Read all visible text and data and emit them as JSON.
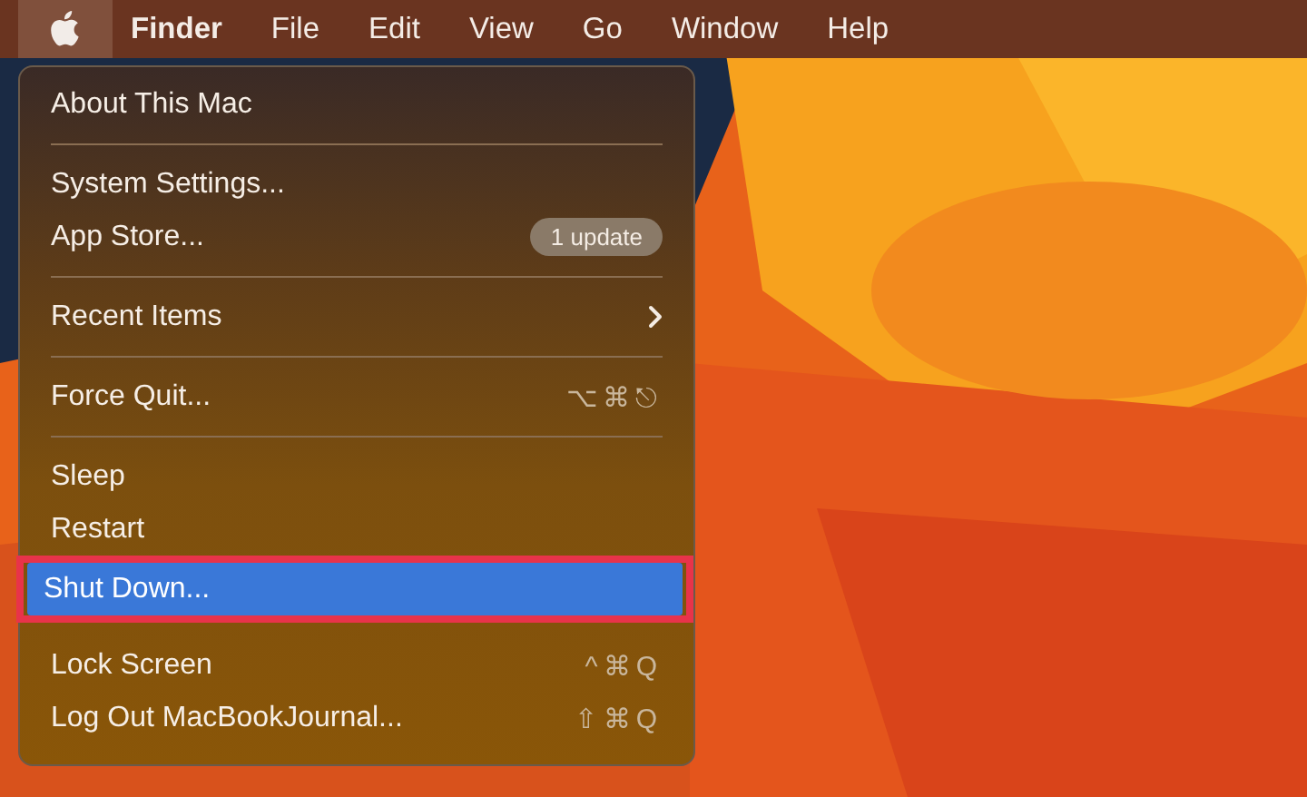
{
  "menu_bar": {
    "apple_menu_selected": true,
    "items": [
      {
        "label": "Finder",
        "bold": true
      },
      {
        "label": "File",
        "bold": false
      },
      {
        "label": "Edit",
        "bold": false
      },
      {
        "label": "View",
        "bold": false
      },
      {
        "label": "Go",
        "bold": false
      },
      {
        "label": "Window",
        "bold": false
      },
      {
        "label": "Help",
        "bold": false
      }
    ]
  },
  "apple_menu": {
    "items": [
      {
        "kind": "item",
        "label": "About This Mac",
        "selected": false
      },
      {
        "kind": "separator"
      },
      {
        "kind": "item",
        "label": "System Settings...",
        "selected": false
      },
      {
        "kind": "item",
        "label": "App Store...",
        "badge": "1 update",
        "selected": false
      },
      {
        "kind": "separator"
      },
      {
        "kind": "item",
        "label": "Recent Items",
        "submenu": true,
        "selected": false
      },
      {
        "kind": "separator"
      },
      {
        "kind": "item",
        "label": "Force Quit...",
        "shortcut": "⌥⌘⎋",
        "selected": false
      },
      {
        "kind": "separator"
      },
      {
        "kind": "item",
        "label": "Sleep",
        "selected": false
      },
      {
        "kind": "item",
        "label": "Restart",
        "selected": false
      },
      {
        "kind": "item",
        "label": "Shut Down...",
        "selected": true,
        "outlined": true
      },
      {
        "kind": "item",
        "label": "Lock Screen",
        "shortcut": "^⌘Q",
        "selected": false
      },
      {
        "kind": "item",
        "label": "Log Out MacBookJournal...",
        "shortcut": "⇧⌘Q",
        "selected": false
      }
    ]
  }
}
